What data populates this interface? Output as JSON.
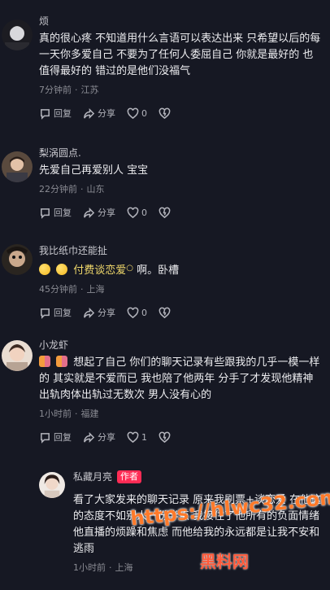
{
  "comments": [
    {
      "username": "烦",
      "text": "真的很心疼 不知道用什么言语可以表达出来 只希望以后的每一天你多爱自己 不要为了任何人委屈自己 你就是最好的 也值得最好的 错过的是他们没福气",
      "time": "7分钟前",
      "location": "江苏",
      "reply_label": "回复",
      "share_label": "分享",
      "like_count": "0"
    },
    {
      "username": "梨涡圆点.",
      "text": "先爱自己再爱别人 宝宝",
      "time": "22分钟前",
      "location": "山东",
      "reply_label": "回复",
      "share_label": "分享",
      "like_count": "0"
    },
    {
      "username": "我比纸巾还能扯",
      "text_pre": "",
      "text_link": "付费谈恋爱",
      "text_post": "啊。卧槽",
      "time": "45分钟前",
      "location": "上海",
      "reply_label": "回复",
      "share_label": "分享",
      "like_count": "0"
    },
    {
      "username": "小龙虾",
      "text": "想起了自己 你们的聊天记录有些跟我的几乎一模一样的 其实就是不爱而已 我也陪了他两年 分手了才发现他精神出轨肉体出轨过无数次 男人没有心的",
      "time": "1小时前",
      "location": "福建",
      "reply_label": "回复",
      "share_label": "分享",
      "like_count": "1"
    },
    {
      "username": "私藏月亮",
      "badge": "作者",
      "text": "看了大家发来的聊天记录 原来我刷票+谈恋爱 在他这的态度不如别人一份半点 我接住了他所有的负面情绪 他直播的烦躁和焦虑 而他给我的永远都是让我不安和逃雨",
      "time": "1小时前",
      "location": "上海"
    }
  ],
  "watermark": {
    "url": "https://hlwc32.com",
    "name": "黑料网"
  },
  "colors": {
    "background": "#161823",
    "author_badge": "#fe2c55",
    "highlight": "#f0d86b"
  },
  "icons": [
    "reply-icon",
    "share-icon",
    "like-icon",
    "dislike-icon",
    "smile-emoji",
    "couple-emoji"
  ]
}
